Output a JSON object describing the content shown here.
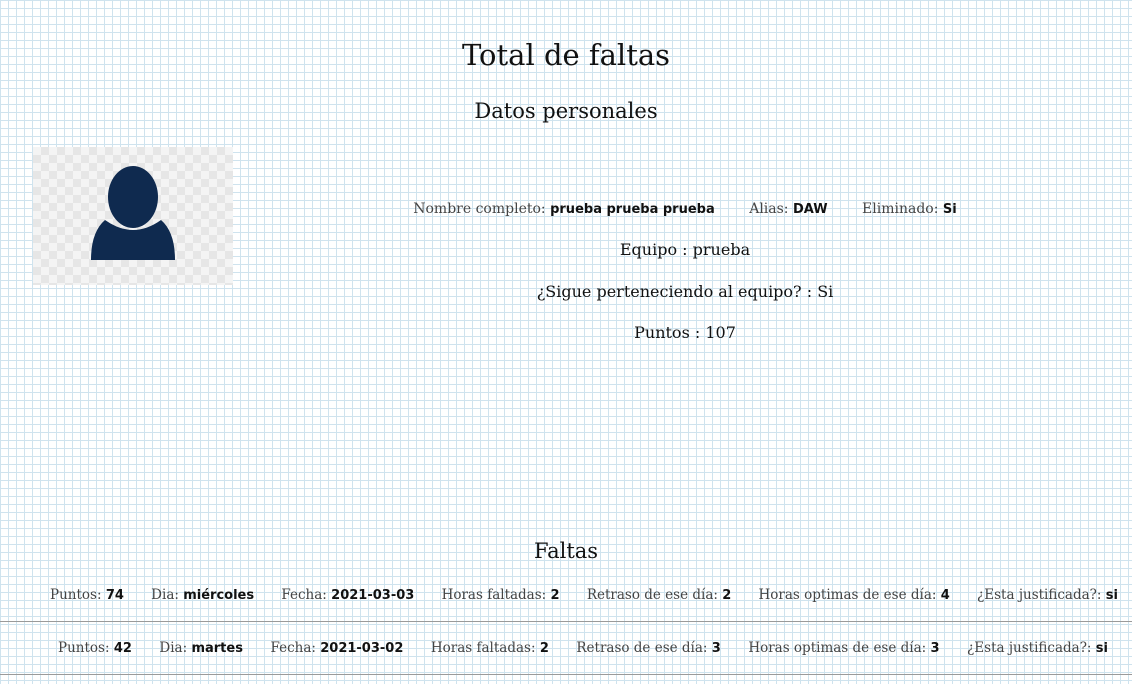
{
  "page": {
    "title": "Total de faltas",
    "section_title": "Datos personales"
  },
  "avatar": {
    "icon": "user-silhouette-icon",
    "color": "#0f2a4f"
  },
  "personal": {
    "nombre_label": "Nombre completo:",
    "nombre_value": "prueba prueba prueba",
    "alias_label": "Alias:",
    "alias_value": "DAW",
    "eliminado_label": "Eliminado:",
    "eliminado_value": "Si",
    "equipo_text": "Equipo : prueba",
    "sigue_text": "¿Sigue perteneciendo al equipo? : Si",
    "puntos_text": "Puntos : 107"
  },
  "faltas": {
    "title": "Faltas",
    "labels": {
      "puntos": "Puntos:",
      "dia": "Dia:",
      "fecha": "Fecha:",
      "horas_faltadas": "Horas faltadas:",
      "retraso": "Retraso de ese día:",
      "horas_optimas": "Horas optimas de ese día:",
      "justificada": "¿Esta justificada?:"
    },
    "rows": [
      {
        "puntos": "74",
        "dia": "miércoles",
        "fecha": "2021-03-03",
        "horas_faltadas": "2",
        "retraso": "2",
        "horas_optimas": "4",
        "justificada": "si"
      },
      {
        "puntos": "42",
        "dia": "martes",
        "fecha": "2021-03-02",
        "horas_faltadas": "2",
        "retraso": "3",
        "horas_optimas": "3",
        "justificada": "si"
      }
    ]
  }
}
